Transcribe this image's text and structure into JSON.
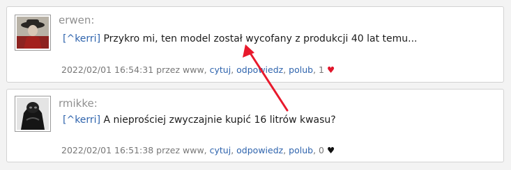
{
  "comments": [
    {
      "author": "erwen:",
      "reply_to": "[^kerri]",
      "text": " Przykro mi, ten model został wycofany z produkcji 40 lat temu...",
      "timestamp": "2022/02/01 16:54:31 przez www,",
      "actions": {
        "quote": "cytuj",
        "reply": "odpowiedz",
        "like": "polub"
      },
      "likes": "1",
      "heart": "♥"
    },
    {
      "author": "rmikke:",
      "reply_to": "[^kerri]",
      "text": " A nieprościej zwyczajnie kupić 16 litrów kwasu?",
      "timestamp": "2022/02/01 16:51:38 przez www,",
      "actions": {
        "quote": "cytuj",
        "reply": "odpowiedz",
        "like": "polub"
      },
      "likes": "0",
      "heart": "♥"
    }
  ],
  "colors": {
    "link": "#2f64ad",
    "heart_liked": "#e0162b",
    "annotation_arrow": "#e8192c"
  }
}
